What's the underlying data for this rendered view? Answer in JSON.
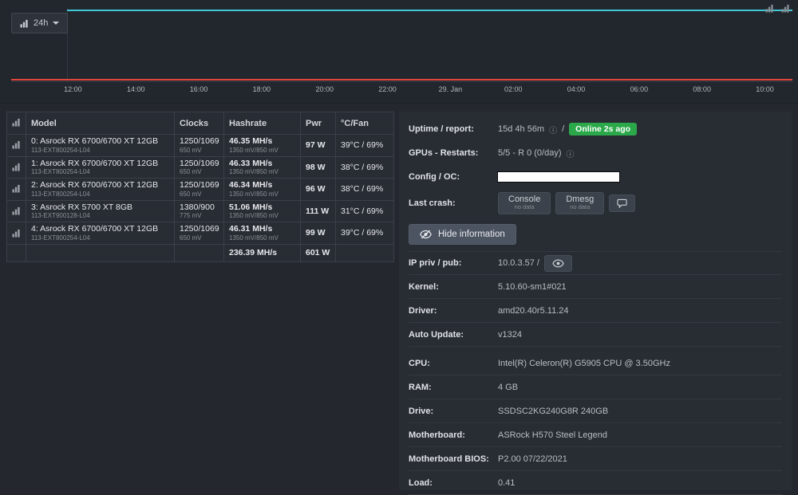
{
  "colors": {
    "online_badge": "#2ba84a",
    "hashrate_line": "#3fc8d7",
    "temp_line": "#e0483c"
  },
  "icons": {
    "info": "ⓘ"
  },
  "chart": {
    "range_label": "24h",
    "time_ticks": [
      "12:00",
      "14:00",
      "16:00",
      "18:00",
      "20:00",
      "22:00",
      "29. Jan",
      "02:00",
      "04:00",
      "06:00",
      "08:00",
      "10:00"
    ]
  },
  "gpu_table": {
    "headers": {
      "model": "Model",
      "clocks": "Clocks",
      "hashrate": "Hashrate",
      "pwr": "Pwr",
      "temp_fan": "°C/Fan"
    },
    "rows": [
      {
        "model": "0: Asrock RX 6700/6700 XT 12GB",
        "model_sub": "113-EXT800254-L04",
        "clocks": "1250/1069",
        "clocks_sub": "650 mV",
        "hashrate": "46.35 MH/s",
        "hashrate_sub": "1350 mV/850 mV",
        "pwr": "97 W",
        "temp_fan": "39°C / 69%"
      },
      {
        "model": "1: Asrock RX 6700/6700 XT 12GB",
        "model_sub": "113-EXT800254-L04",
        "clocks": "1250/1069",
        "clocks_sub": "650 mV",
        "hashrate": "46.33 MH/s",
        "hashrate_sub": "1350 mV/850 mV",
        "pwr": "98 W",
        "temp_fan": "38°C / 69%"
      },
      {
        "model": "2: Asrock RX 6700/6700 XT 12GB",
        "model_sub": "113-EXT800254-L04",
        "clocks": "1250/1069",
        "clocks_sub": "650 mV",
        "hashrate": "46.34 MH/s",
        "hashrate_sub": "1350 mV/850 mV",
        "pwr": "96 W",
        "temp_fan": "38°C / 69%"
      },
      {
        "model": "3: Asrock RX 5700 XT 8GB",
        "model_sub": "113-EXT900128-L04",
        "clocks": "1380/900",
        "clocks_sub": "775 mV",
        "hashrate": "51.06 MH/s",
        "hashrate_sub": "1350 mV/850 mV",
        "pwr": "111 W",
        "temp_fan": "31°C / 69%"
      },
      {
        "model": "4: Asrock RX 6700/6700 XT 12GB",
        "model_sub": "113-EXT800254-L04",
        "clocks": "1250/1069",
        "clocks_sub": "650 mV",
        "hashrate": "46.31 MH/s",
        "hashrate_sub": "1350 mV/850 mV",
        "pwr": "99 W",
        "temp_fan": "39°C / 69%"
      }
    ],
    "total": {
      "hashrate": "236.39 MH/s",
      "pwr": "601 W"
    }
  },
  "info": {
    "uptime_label": "Uptime / report:",
    "uptime_value": "15d 4h 56m",
    "uptime_sep": "/",
    "online_badge": "Online 2s ago",
    "gpus_label": "GPUs - Restarts:",
    "gpus_value": "5/5 - R 0 (0/day)",
    "config_label": "Config / OC:",
    "crash_label": "Last crash:",
    "console_btn": "Console",
    "console_sub": "no data",
    "dmesg_btn": "Dmesg",
    "dmesg_sub": "no data",
    "hide_info_btn": "Hide information",
    "ip_label": "IP priv / pub:",
    "ip_value": "10.0.3.57 /",
    "kernel_label": "Kernel:",
    "kernel_value": "5.10.60-sm1#021",
    "driver_label": "Driver:",
    "driver_value": "amd20.40r5.11.24",
    "autoupdate_label": "Auto Update:",
    "autoupdate_value": "v1324",
    "cpu_label": "CPU:",
    "cpu_value": "Intel(R) Celeron(R) G5905 CPU @ 3.50GHz",
    "ram_label": "RAM:",
    "ram_value": "4 GB",
    "drive_label": "Drive:",
    "drive_value": "SSDSC2KG240G8R 240GB",
    "mb_label": "Motherboard:",
    "mb_value": "ASRock H570 Steel Legend",
    "bios_label": "Motherboard BIOS:",
    "bios_value": "P2.00 07/22/2021",
    "load_label": "Load:",
    "load_value": "0.41"
  }
}
